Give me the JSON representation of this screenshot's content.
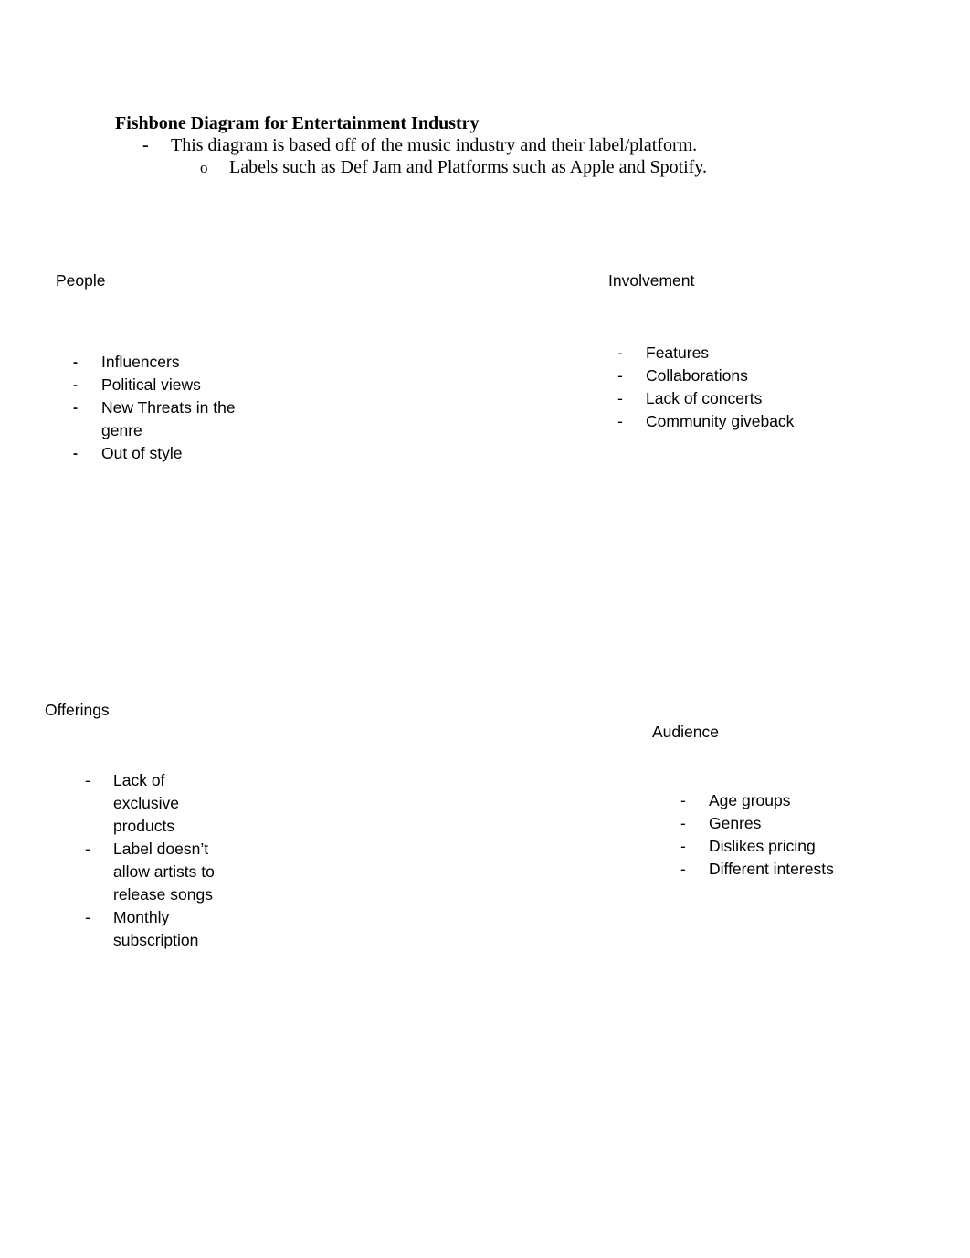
{
  "document": {
    "title": "Fishbone Diagram for Entertainment Industry",
    "intro": {
      "bullet_marker": "-",
      "text": "This diagram is based off of the music industry and their label/platform.",
      "sub": {
        "bullet_marker": "o",
        "text": "Labels such as Def Jam and Platforms such as Apple and Spotify."
      }
    }
  },
  "sections": {
    "people": {
      "heading": "People",
      "items": [
        "Influencers",
        "Political views",
        "New Threats in the genre",
        "Out of style"
      ]
    },
    "involvement": {
      "heading": "Involvement",
      "items": [
        "Features",
        "Collaborations",
        "Lack of concerts",
        "Community giveback"
      ]
    },
    "offerings": {
      "heading": "Offerings",
      "items": [
        "Lack of exclusive products",
        "Label doesn’t allow artists to release songs",
        "Monthly subscription"
      ]
    },
    "audience": {
      "heading": "Audience",
      "items": [
        "Age groups",
        "Genres",
        "Dislikes pricing",
        "Different interests"
      ]
    }
  },
  "bullet_dash": "-"
}
